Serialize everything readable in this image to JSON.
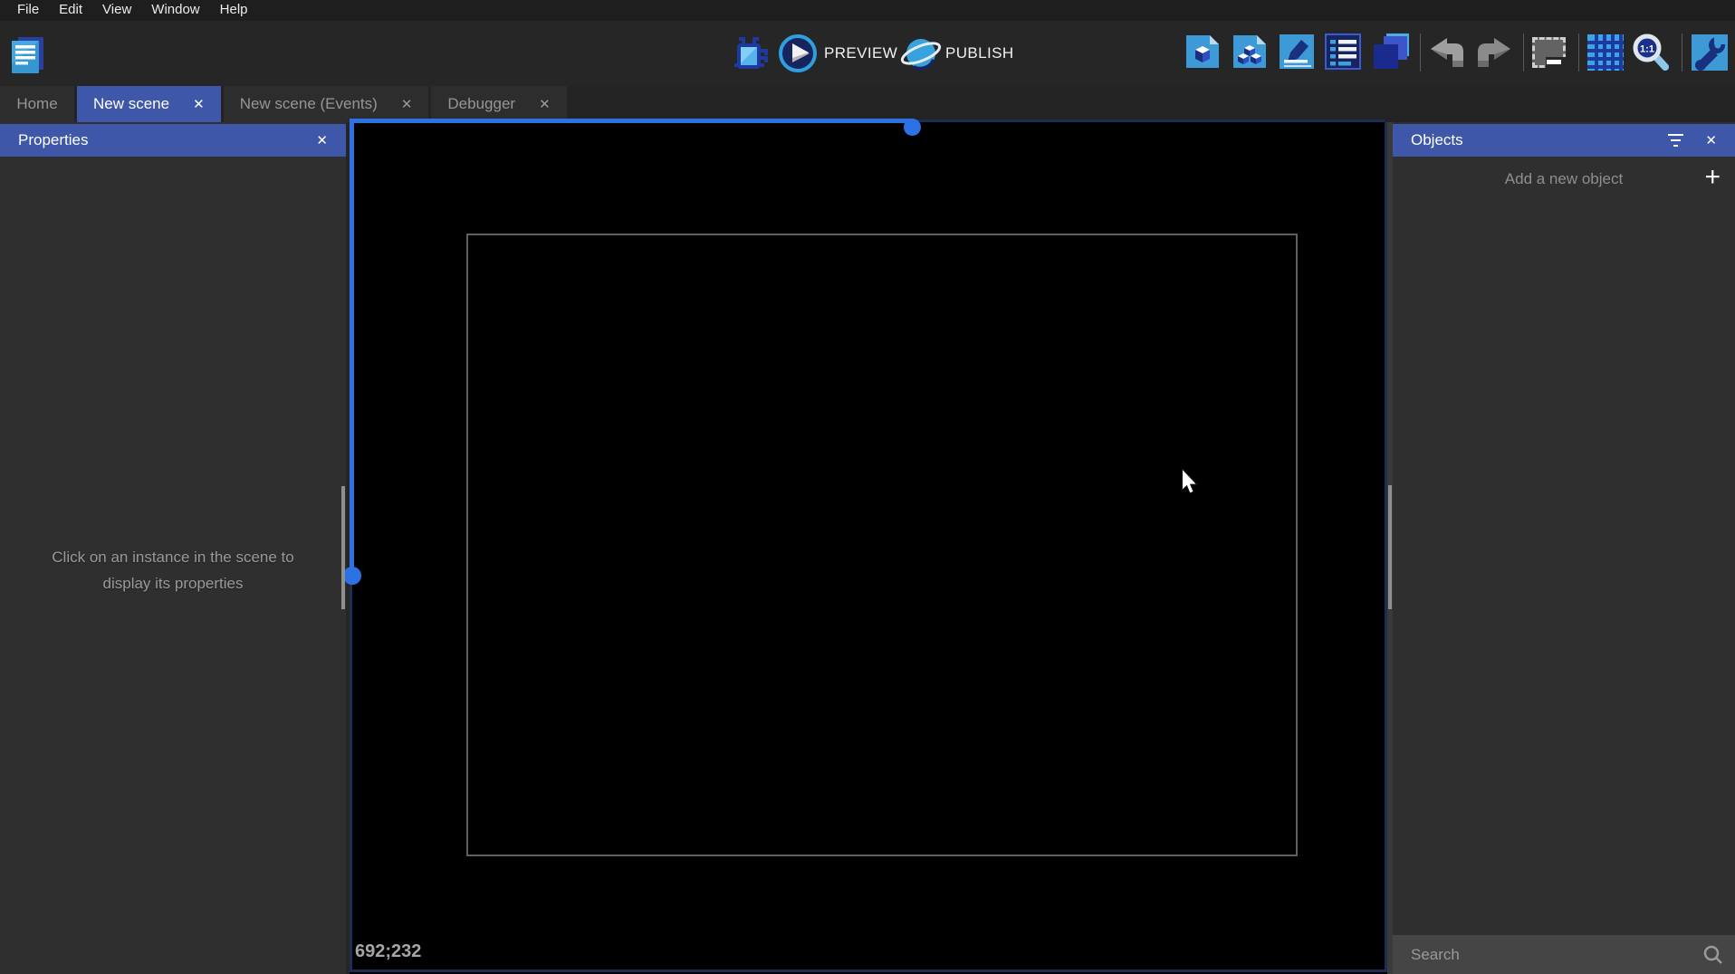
{
  "menu": {
    "items": [
      "File",
      "Edit",
      "View",
      "Window",
      "Help"
    ]
  },
  "toolbar": {
    "preview_label": "PREVIEW",
    "publish_label": "PUBLISH",
    "zoom_ratio_label": "1:1",
    "icons": [
      "project-manager",
      "debugger",
      "preview-play",
      "publish-globe",
      "objects-editor",
      "object-groups-editor",
      "scene-properties-pencil",
      "instances-list",
      "layers-editor",
      "undo",
      "redo",
      "deselect-instances",
      "toggle-grid",
      "zoom-1-1",
      "scene-settings-wrench"
    ]
  },
  "tabs": [
    {
      "label": "Home",
      "active": false,
      "closable": false
    },
    {
      "label": "New scene",
      "active": true,
      "closable": true
    },
    {
      "label": "New scene (Events)",
      "active": false,
      "closable": true
    },
    {
      "label": "Debugger",
      "active": false,
      "closable": true
    }
  ],
  "properties_panel": {
    "title": "Properties",
    "empty_message_line1": "Click on an instance in the scene to",
    "empty_message_line2": "display its properties"
  },
  "objects_panel": {
    "title": "Objects",
    "add_button_label": "Add a new object",
    "search_placeholder": "Search"
  },
  "scene_canvas": {
    "cursor_coordinates": "692;232"
  },
  "ui": {
    "close_glyph": "✕",
    "plus_glyph": "+"
  },
  "colors": {
    "accent_blue": "#3e57a8",
    "selection_blue": "#2d72e4",
    "selection_navy": "#1d2e52",
    "icon_light_blue": "#3d9ad6",
    "icon_navy": "#18307e",
    "panel_bg": "#2f2f2f",
    "canvas_bg": "#000000"
  }
}
